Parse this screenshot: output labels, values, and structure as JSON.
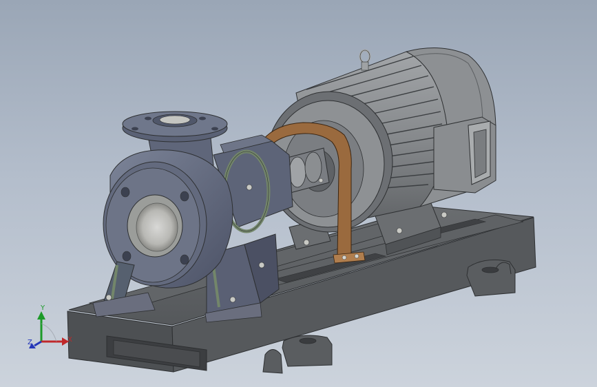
{
  "viewport": {
    "background_top": "#9aa6b6",
    "background_bottom": "#ccd3dc"
  },
  "model": {
    "parts": [
      "baseplate",
      "pump-casing",
      "suction-flange",
      "discharge-flange",
      "bearing-housing",
      "coupling",
      "coupling-guard",
      "electric-motor",
      "motor-fan-cover",
      "terminal-box",
      "lifting-eye"
    ],
    "colors": {
      "baseplate": "#5c5f62",
      "pump": "#5d6478",
      "motor": "#808386",
      "coupling_guard": "#9a6a3e",
      "green_ring": "#73866a"
    }
  },
  "triad": {
    "x_label": "X",
    "y_label": "Y",
    "z_label": "Z",
    "x_color": "#c0282a",
    "y_color": "#1c9a28",
    "z_color": "#2436b8"
  }
}
